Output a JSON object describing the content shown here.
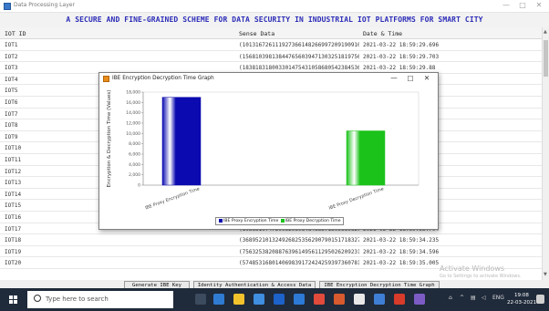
{
  "window": {
    "title": "Data Processing Layer",
    "banner": "A SECURE AND FINE-GRAINED SCHEME FOR DATA SECURITY IN INDUSTRIAL IOT PLATFORMS FOR SMART CITY"
  },
  "table": {
    "headers": [
      "IOT ID",
      "Sense Data",
      "Date & Time"
    ],
    "rows": [
      {
        "id": "IOT1",
        "data": "(101316726111927366148266997209190910549381112389501...",
        "time": "2021-03-22 18:59:29.696"
      },
      {
        "id": "IOT2",
        "data": "(156810398138447656039471303251819756358826303919484...",
        "time": "2021-03-22 18:59:29.703"
      },
      {
        "id": "IOT3",
        "data": "(183818318003301475431058680542384536509849849826...",
        "time": "2021-03-22 18:59:29.88"
      },
      {
        "id": "IOT4",
        "data": "",
        "time": ""
      },
      {
        "id": "IOT5",
        "data": "",
        "time": ""
      },
      {
        "id": "IOT6",
        "data": "",
        "time": ""
      },
      {
        "id": "IOT7",
        "data": "",
        "time": ""
      },
      {
        "id": "IOT8",
        "data": "",
        "time": ""
      },
      {
        "id": "IOT9",
        "data": "",
        "time": ""
      },
      {
        "id": "IOT10",
        "data": "",
        "time": ""
      },
      {
        "id": "IOT11",
        "data": "",
        "time": ""
      },
      {
        "id": "IOT12",
        "data": "",
        "time": ""
      },
      {
        "id": "IOT13",
        "data": "",
        "time": ""
      },
      {
        "id": "IOT14",
        "data": "",
        "time": ""
      },
      {
        "id": "IOT15",
        "data": "",
        "time": ""
      },
      {
        "id": "IOT16",
        "data": "",
        "time": ""
      },
      {
        "id": "IOT17",
        "data": "(103651074720052069848463371305689620521250089514958...",
        "time": "2021-03-22 18:59:33.704"
      },
      {
        "id": "IOT18",
        "data": "(368952101324926825356290790151718327308697597317100...",
        "time": "2021-03-22 18:59:34.235"
      },
      {
        "id": "IOT19",
        "data": "(756325382088763961495611295026209231291075383113...",
        "time": "2021-03-22 18:59:34.596"
      },
      {
        "id": "IOT20",
        "data": "(574853168014069839172424259397360781761290354636652...",
        "time": "2021-03-22 18:59:35.005"
      }
    ]
  },
  "buttons": {
    "generate": "Generate IBE Key",
    "identity": "Identity Authentication & Access Data",
    "graph": "IBE Encryption Decryption Time Graph"
  },
  "dialog": {
    "title": "IBE Encryption Decryption Time Graph",
    "minimize": "—",
    "maximize": "□",
    "close": "✕"
  },
  "chart_data": {
    "type": "bar",
    "title": "",
    "categories": [
      "IBE Proxy Encryption Time",
      "IBE Proxy Decryption Time"
    ],
    "values": [
      17000,
      10500
    ],
    "colors": [
      "#0a0ab0",
      "#1ac21a"
    ],
    "ylabel": "Encryption & Decryption Time (Values)",
    "ylim": [
      0,
      18000
    ],
    "yticks": [
      "0",
      "2,000",
      "4,000",
      "6,000",
      "8,000",
      "10,000",
      "12,000",
      "14,000",
      "16,000",
      "18,000"
    ],
    "legend": [
      "IBE Proxy Encryption Time",
      "IBE Proxy Decryption Time"
    ],
    "legend_position": "bottom",
    "grid": false
  },
  "watermark": {
    "line1": "Activate Windows",
    "line2": "Go to Settings to activate Windows."
  },
  "taskbar": {
    "search_placeholder": "Type here to search",
    "time": "19:08",
    "date": "22-03-2021",
    "lang": "ENG"
  }
}
